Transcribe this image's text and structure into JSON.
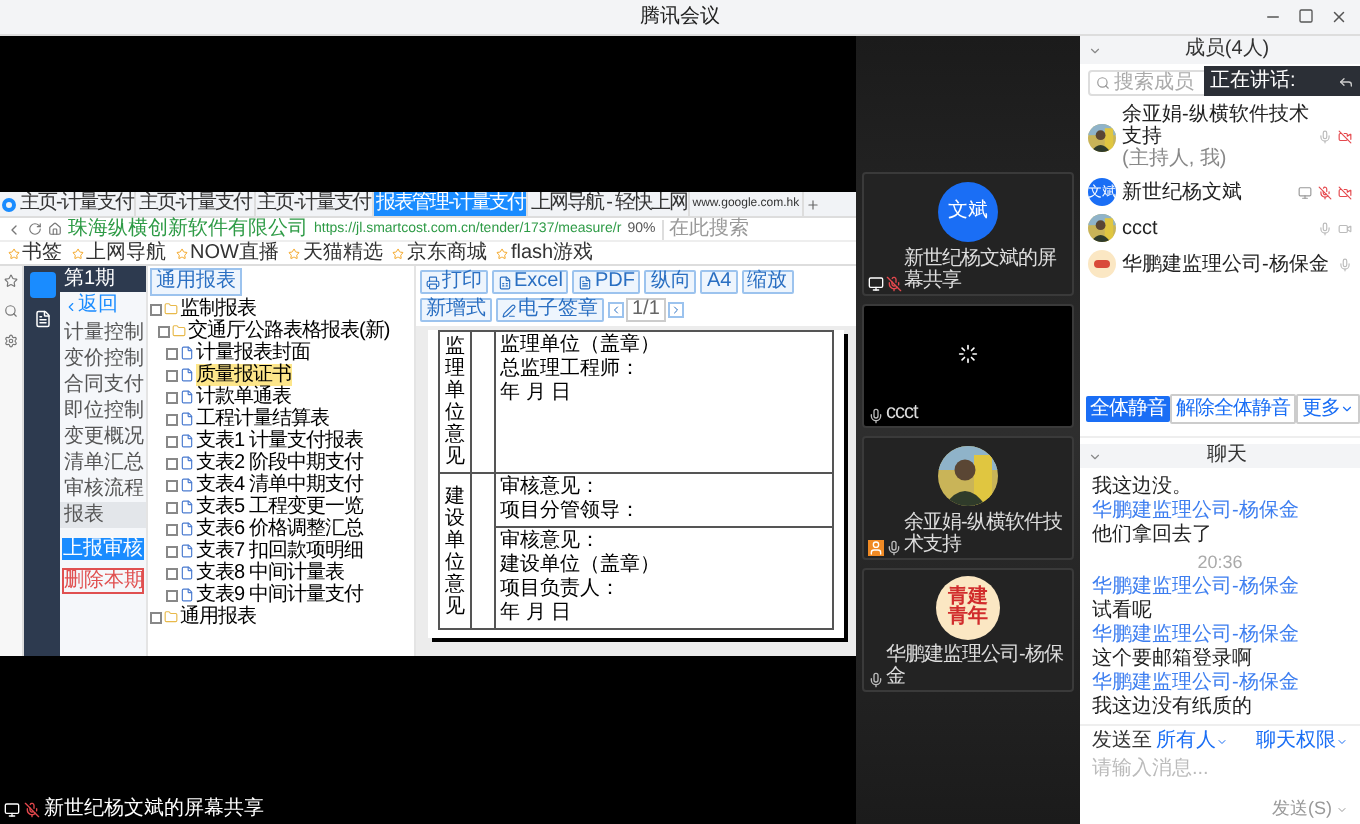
{
  "window": {
    "title": "腾讯会议"
  },
  "shared_screen": {
    "label": "新世纪杨文斌的屏幕共享",
    "browser": {
      "tabs": [
        {
          "label": "主页-计量支付",
          "selected": false
        },
        {
          "label": "主页-计量支付",
          "selected": false
        },
        {
          "label": "主页-计量支付",
          "selected": false
        },
        {
          "label": "报表管理-计量支付",
          "selected": true
        },
        {
          "label": "上网导航 - 轻快上网",
          "selected": false
        },
        {
          "label": "www.google.com.hk",
          "selected": false
        }
      ],
      "site_name": "珠海纵横创新软件有限公司",
      "url": "https://jl.smartcost.com.cn/tender/1737/measure/r",
      "zoom": "90%",
      "search_placeholder": "在此搜索",
      "bookmarks": [
        "书签",
        "上网导航",
        "NOW直播",
        "天猫精选",
        "京东商城",
        "flash游戏"
      ]
    },
    "app": {
      "period": "第1期",
      "report_button": "通用报表",
      "back": "返回",
      "menu": [
        {
          "label": "计量控制",
          "selected": false
        },
        {
          "label": "变价控制",
          "selected": false
        },
        {
          "label": "合同支付",
          "selected": false
        },
        {
          "label": "即位控制",
          "selected": false
        },
        {
          "label": "变更概况",
          "selected": false
        },
        {
          "label": "清单汇总",
          "selected": false
        },
        {
          "label": "审核流程",
          "selected": false
        },
        {
          "label": "报表",
          "selected": true
        }
      ],
      "submit_button": "上报审核",
      "delete_button": "删除本期",
      "tree": [
        {
          "label": "监制报表",
          "checked": false,
          "children": [
            {
              "label": "交通厅公路表格报表(新)",
              "checked": false,
              "children": [
                {
                  "label": "计量报表封面",
                  "checked": false,
                  "selected": false
                },
                {
                  "label": "质量报证书",
                  "checked": false,
                  "selected": true
                },
                {
                  "label": "计款单通表",
                  "checked": false,
                  "selected": false
                },
                {
                  "label": "工程计量结算表",
                  "checked": false,
                  "selected": false
                },
                {
                  "label": "支表1 计量支付报表",
                  "checked": false,
                  "selected": false
                },
                {
                  "label": "支表2 阶段中期支付",
                  "checked": false,
                  "selected": false
                },
                {
                  "label": "支表4 清单中期支付",
                  "checked": false,
                  "selected": false
                },
                {
                  "label": "支表5 工程变更一览",
                  "checked": false,
                  "selected": false
                },
                {
                  "label": "支表6 价格调整汇总",
                  "checked": false,
                  "selected": false
                },
                {
                  "label": "支表7 扣回款项明细",
                  "checked": false,
                  "selected": false
                },
                {
                  "label": "支表8 中间计量表",
                  "checked": false,
                  "selected": false
                },
                {
                  "label": "支表9 中间计量支付",
                  "checked": false,
                  "selected": false
                }
              ]
            }
          ]
        },
        {
          "label": "通用报表",
          "checked": false
        }
      ],
      "toolbar": [
        {
          "kind": "print",
          "label": "打印"
        },
        {
          "kind": "excel",
          "label": "Excel"
        },
        {
          "kind": "pdf",
          "label": "PDF"
        },
        {
          "kind": "text",
          "label": "纵向"
        },
        {
          "kind": "text",
          "label": "A4"
        },
        {
          "kind": "text",
          "label": "缩放"
        },
        {
          "kind": "text",
          "label": "新增式"
        },
        {
          "kind": "sign",
          "label": "电子签章"
        },
        {
          "kind": "pager",
          "label": "1/1"
        }
      ],
      "document": [
        {
          "heading": "监理单位意见",
          "blocks": [
            {
              "lines": [
                "监理单位（盖章）",
                "总监理工程师：",
                "年 月 日"
              ]
            }
          ]
        },
        {
          "heading": "建设单位意见",
          "blocks": [
            {
              "lines": [
                "审核意见：",
                "项目分管领导："
              ]
            },
            {
              "lines": [
                "审核意见：",
                "建设单位（盖章）",
                "项目负责人：",
                "年 月 日"
              ]
            }
          ]
        }
      ]
    }
  },
  "video_tiles": [
    {
      "kind": "initials",
      "avatar": "文斌",
      "name": "新世纪杨文斌的屏幕共享",
      "sharing": true,
      "host": false,
      "muted": true
    },
    {
      "kind": "video",
      "name": "ccct",
      "sharing": false,
      "host": false,
      "muted": false
    },
    {
      "name": "余亚娟-纵横软件技术支持",
      "sharing": false,
      "host": true,
      "muted": false
    },
    {
      "kind": "logo",
      "avatar": "青建青年",
      "name": "华鹏建监理公司-杨保金",
      "sharing": false,
      "host": false,
      "muted": false
    }
  ],
  "members": {
    "title": "成员(4人)",
    "search_placeholder": "搜索成员",
    "speaking": "正在讲话:",
    "list": [
      {
        "name": "余亚娟-纵横软件技术支持",
        "role": "(主持人, 我)",
        "sharing": false,
        "muted": false,
        "video_off": true
      },
      {
        "kind": "initials",
        "avatar": "文斌",
        "name": "新世纪杨文斌",
        "sharing": true,
        "muted": true,
        "video_off": true
      },
      {
        "name": "ccct",
        "sharing": false,
        "muted": false,
        "video_off": false
      },
      {
        "kind": "logo",
        "name": "华鹏建监理公司-杨保金",
        "sharing": false,
        "muted": false
      }
    ],
    "buttons": [
      {
        "label": "全体静音",
        "primary": true,
        "menu": false
      },
      {
        "label": "解除全体静音",
        "primary": false,
        "menu": false
      },
      {
        "label": "更多",
        "primary": false,
        "menu": true
      }
    ]
  },
  "chat": {
    "title": "聊天",
    "messages": [
      {
        "kind": "text",
        "text": "我这边没。"
      },
      {
        "kind": "sender",
        "text": "华鹏建监理公司-杨保金"
      },
      {
        "kind": "text",
        "text": "他们拿回去了"
      },
      {
        "kind": "time",
        "text": "20:36"
      },
      {
        "kind": "sender",
        "text": "华鹏建监理公司-杨保金"
      },
      {
        "kind": "text",
        "text": "试看呢"
      },
      {
        "kind": "sender",
        "text": "华鹏建监理公司-杨保金"
      },
      {
        "kind": "text",
        "text": "这个要邮箱登录啊"
      },
      {
        "kind": "sender",
        "text": "华鹏建监理公司-杨保金"
      },
      {
        "kind": "text",
        "text": "我这边没有纸质的"
      }
    ],
    "send_to": "发送至",
    "recipient": "所有人",
    "permissions": "聊天权限",
    "placeholder": "请输入消息...",
    "send_button": "发送(S)"
  }
}
